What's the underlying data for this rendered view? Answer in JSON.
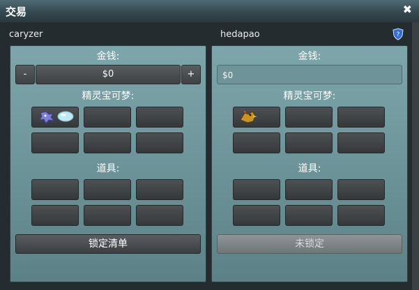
{
  "window": {
    "title": "交易",
    "close_icon": "close-icon"
  },
  "left": {
    "user": "caryzer",
    "money_label": "金钱:",
    "minus_label": "-",
    "amount": "$0",
    "plus_label": "+",
    "pokemon_label": "精灵宝可梦:",
    "items_label": "道具:",
    "action_label": "锁定清单",
    "pokemon_slots": [
      "dragon-and-egg-sprite-icon",
      "",
      "",
      "",
      "",
      ""
    ],
    "item_slots": [
      "",
      "",
      "",
      "",
      "",
      ""
    ]
  },
  "right": {
    "user": "hedapao",
    "money_label": "金钱:",
    "amount": "$0",
    "pokemon_label": "精灵宝可梦:",
    "items_label": "道具:",
    "action_label": "未锁定",
    "pokemon_slots": [
      "bird-sprite-icon",
      "",
      "",
      "",
      "",
      ""
    ],
    "item_slots": [
      "",
      "",
      "",
      "",
      "",
      ""
    ]
  },
  "colors": {
    "panel_top": "#7da6ab",
    "panel_bottom": "#5c8287",
    "slot": "#3d4144"
  }
}
